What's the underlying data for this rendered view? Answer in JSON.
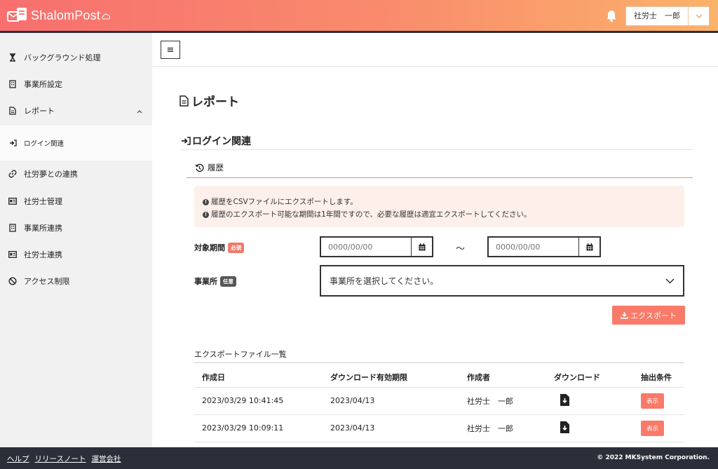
{
  "app": {
    "logo_text": "ShalomPost",
    "user_name": "社労士　一郎"
  },
  "sidebar": {
    "items": [
      {
        "label": "バックグラウンド処理",
        "icon": "hourglass-icon"
      },
      {
        "label": "事業所設定",
        "icon": "building-icon"
      },
      {
        "label": "レポート",
        "icon": "document-icon"
      },
      {
        "label": "ログイン関連",
        "icon": "sign-in-icon"
      },
      {
        "label": "社労夢との連携",
        "icon": "link-icon"
      },
      {
        "label": "社労士管理",
        "icon": "id-card-icon"
      },
      {
        "label": "事業所連携",
        "icon": "building-icon"
      },
      {
        "label": "社労士連携",
        "icon": "id-card-icon"
      },
      {
        "label": "アクセス制限",
        "icon": "ban-icon"
      }
    ]
  },
  "main": {
    "menu_glyph": "≡",
    "page_title": "レポート",
    "section_title": "ログイン関連",
    "tab_label": "履歴",
    "alert_lines": [
      "履歴をCSVファイルにエクスポートします。",
      "履歴のエクスポート可能な期間は1年間ですので、必要な履歴は適宜エクスポートしてください。"
    ],
    "form": {
      "period_label": "対象期間",
      "required_badge": "必須",
      "date_from_placeholder": "0000/00/00",
      "date_to_placeholder": "0000/00/00",
      "tilde": "～",
      "office_label": "事業所",
      "optional_badge": "任意",
      "office_placeholder": "事業所を選択してください。"
    },
    "export_label": "エクスポート",
    "list_title": "エクスポートファイル一覧",
    "table": {
      "headers": [
        "作成日",
        "ダウンロード有効期限",
        "作成者",
        "ダウンロード",
        "抽出条件"
      ],
      "rows": [
        {
          "created": "2023/03/29 10:41:45",
          "expires": "2023/04/13",
          "author": "社労士　一郎",
          "show": "表示"
        },
        {
          "created": "2023/03/29 10:09:11",
          "expires": "2023/04/13",
          "author": "社労士　一郎",
          "show": "表示"
        }
      ]
    }
  },
  "footer": {
    "links": [
      "ヘルプ",
      "リリースノート",
      "運営会社"
    ],
    "copyright": "© 2022 MKSystem Corporation."
  },
  "colors": {
    "accent": "#f97a69",
    "dark": "#2c2f3a"
  }
}
